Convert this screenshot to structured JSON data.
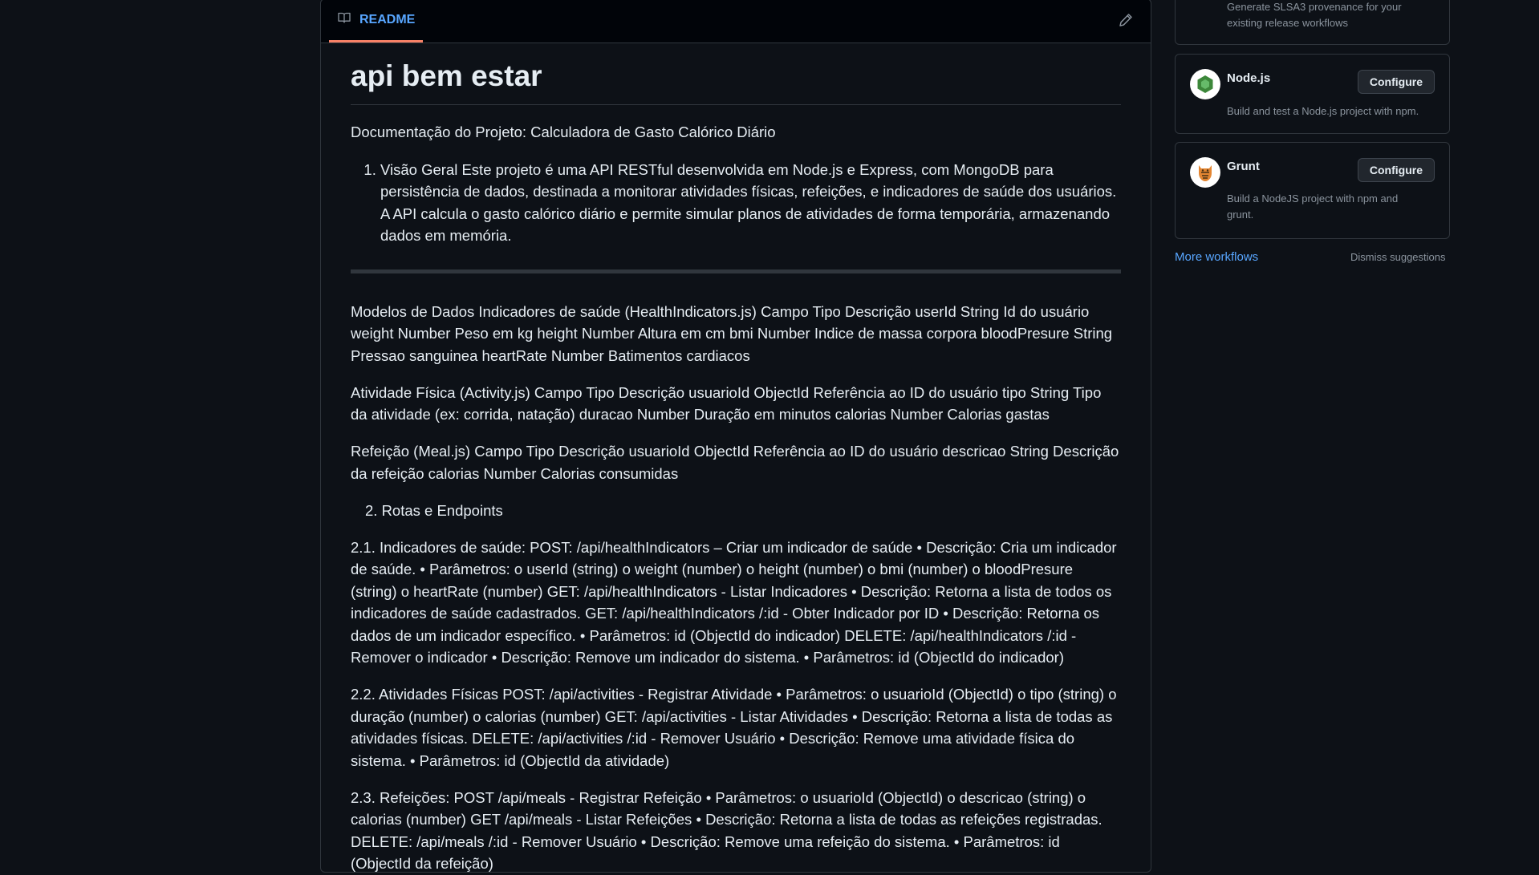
{
  "readme": {
    "tab_label": "README",
    "title": "api bem estar",
    "intro": "Documentação do Projeto: Calculadora de Gasto Calórico Diário",
    "overview_item": "Visão Geral Este projeto é uma API RESTful desenvolvida em Node.js e Express, com MongoDB para persistência de dados, destinada a monitorar atividades físicas, refeições, e indicadores de saúde dos usuários. A API calcula o gasto calórico diário e permite simular planos de atividades de forma temporária, armazenando dados em memória.",
    "paragraphs": [
      "Modelos de Dados Indicadores de saúde (HealthIndicators.js) Campo Tipo Descrição userId String Id do usuário weight Number Peso em kg height Number Altura em cm bmi Number Indice de massa corpora bloodPresure String Pressao sanguinea heartRate Number Batimentos cardiacos",
      "Atividade Física (Activity.js) Campo Tipo Descrição usuarioId ObjectId Referência ao ID do usuário tipo String Tipo da atividade (ex: corrida, natação) duracao Number Duração em minutos calorias Number Calorias gastas",
      "Refeição (Meal.js) Campo Tipo Descrição usuarioId ObjectId Referência ao ID do usuário descricao String Descrição da refeição calorias Number Calorias consumidas",
      "2. Rotas e Endpoints",
      "2.1. Indicadores de saúde: POST: /api/healthIndicators – Criar um indicador de saúde • Descrição: Cria um indicador de saúde. • Parâmetros: o userId (string) o weight (number) o height (number) o bmi (number) o bloodPresure (string) o heartRate (number) GET: /api/healthIndicators - Listar Indicadores • Descrição: Retorna a lista de todos os indicadores de saúde cadastrados. GET: /api/healthIndicators /:id - Obter Indicador por ID • Descrição: Retorna os dados de um indicador específico. • Parâmetros: id (ObjectId do indicador) DELETE: /api/healthIndicators /:id - Remover o indicador • Descrição: Remove um indicador do sistema. • Parâmetros: id (ObjectId do indicador)",
      "2.2. Atividades Físicas POST: /api/activities - Registrar Atividade • Parâmetros: o usuarioId (ObjectId) o tipo (string) o duração (number) o calorias (number) GET: /api/activities - Listar Atividades • Descrição: Retorna a lista de todas as atividades físicas. DELETE: /api/activities /:id - Remover Usuário • Descrição: Remove uma atividade física do sistema. • Parâmetros: id (ObjectId da atividade)",
      "2.3. Refeições: POST /api/meals - Registrar Refeição • Parâmetros: o usuarioId (ObjectId) o descricao (string) o calorias (number) GET /api/meals - Listar Refeições • Descrição: Retorna a lista de todas as refeições registradas. DELETE: /api/meals /:id - Remover Usuário • Descrição: Remove uma refeição do sistema. • Parâmetros: id (ObjectId da refeição)"
    ]
  },
  "sidebar": {
    "top_card_desc": "Generate SLSA3 provenance for your existing release workflows",
    "workflows": [
      {
        "name": "Node.js",
        "description": "Build and test a Node.js project with npm.",
        "button": "Configure",
        "icon": "nodejs-icon",
        "icon_color": "#3c873a"
      },
      {
        "name": "Grunt",
        "description": "Build a NodeJS project with npm and grunt.",
        "button": "Configure",
        "icon": "grunt-icon",
        "icon_color": "#e48632"
      }
    ],
    "more_workflows": "More workflows",
    "dismiss": "Dismiss suggestions"
  },
  "colors": {
    "background": "#0d1117",
    "link": "#58a6ff",
    "tab_underline": "#f78166",
    "border": "#30363d"
  }
}
